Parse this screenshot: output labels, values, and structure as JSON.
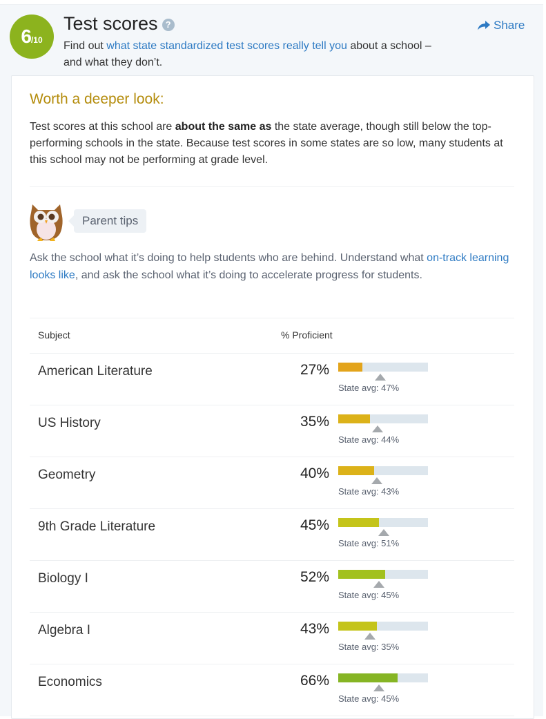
{
  "header": {
    "rating": "6",
    "rating_denominator": "/10",
    "title": "Test scores",
    "help_icon": "question-circle-icon",
    "subtitle_prefix": "Find out ",
    "subtitle_link": "what state standardized test scores really tell you",
    "subtitle_suffix": " about a school – and what they don’t.",
    "share_label": "Share",
    "share_icon": "share-arrow-icon"
  },
  "summary": {
    "heading": "Worth a deeper look:",
    "text_prefix": "Test scores at this school are ",
    "text_bold": "about the same as",
    "text_suffix": " the state average, though still below the top-performing schools in the state. Because test scores in some states are so low, many students at this school may not be performing at grade level."
  },
  "tips": {
    "icon": "owl-icon",
    "label": "Parent tips",
    "text_prefix": "Ask the school what it’s doing to help students who are behind. Understand what ",
    "text_link": "on-track learning looks like",
    "text_suffix": ", and ask the school what it’s doing to accelerate progress for students."
  },
  "table": {
    "col_subject": "Subject",
    "col_proficient": "% Proficient",
    "rows": [
      {
        "subject": "American Literature",
        "pct_label": "27%",
        "value": 27,
        "avg_label": "State avg: 47%",
        "avg": 47,
        "color": "#e3a41b"
      },
      {
        "subject": "US History",
        "pct_label": "35%",
        "value": 35,
        "avg_label": "State avg: 44%",
        "avg": 44,
        "color": "#dcb219"
      },
      {
        "subject": "Geometry",
        "pct_label": "40%",
        "value": 40,
        "avg_label": "State avg: 43%",
        "avg": 43,
        "color": "#dcb219"
      },
      {
        "subject": "9th Grade Literature",
        "pct_label": "45%",
        "value": 45,
        "avg_label": "State avg: 51%",
        "avg": 51,
        "color": "#c4c41a"
      },
      {
        "subject": "Biology I",
        "pct_label": "52%",
        "value": 52,
        "avg_label": "State avg: 45%",
        "avg": 45,
        "color": "#a2c11e"
      },
      {
        "subject": "Algebra I",
        "pct_label": "43%",
        "value": 43,
        "avg_label": "State avg: 35%",
        "avg": 35,
        "color": "#c4c41a"
      },
      {
        "subject": "Economics",
        "pct_label": "66%",
        "value": 66,
        "avg_label": "State avg: 45%",
        "avg": 45,
        "color": "#86b524"
      }
    ]
  },
  "colors": {
    "rating_badge": "#8cb31e",
    "link": "#2d7ac3",
    "heading_gold": "#b48c0c",
    "bar_track": "#dde6ed",
    "avg_marker": "#a5a9ad"
  }
}
